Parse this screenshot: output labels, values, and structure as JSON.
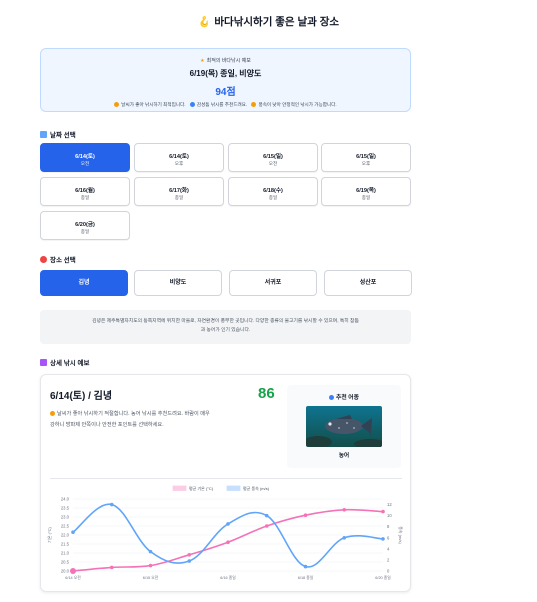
{
  "page": {
    "title": "바다낚시하기 좋은 날과 장소"
  },
  "best_forecast": {
    "label": "최적의 바다낚시 예보",
    "datetime": "6/19(목) 종일, 비양도",
    "score": "94점",
    "tips": [
      "날씨가 좋아 낚시하기 최적입니다.",
      "감성돔 낚시를 추천드려요.",
      "풍속이 낮아 안정적인 낚시가 가능합니다."
    ],
    "tip_colors": [
      "#f59e0b",
      "#3b82f6",
      "#f59e0b"
    ]
  },
  "date_section": {
    "title": "날짜 선택",
    "dates": [
      {
        "date": "6/14(토)",
        "period": "오전",
        "active": true
      },
      {
        "date": "6/14(토)",
        "period": "오후",
        "active": false
      },
      {
        "date": "6/15(일)",
        "period": "오전",
        "active": false
      },
      {
        "date": "6/15(일)",
        "period": "오후",
        "active": false
      },
      {
        "date": "6/16(월)",
        "period": "종일",
        "active": false
      },
      {
        "date": "6/17(화)",
        "period": "종일",
        "active": false
      },
      {
        "date": "6/18(수)",
        "period": "종일",
        "active": false
      },
      {
        "date": "6/19(목)",
        "period": "종일",
        "active": false
      },
      {
        "date": "6/20(금)",
        "period": "종일",
        "active": false
      }
    ]
  },
  "location_section": {
    "title": "장소 선택",
    "locations": [
      {
        "name": "김녕",
        "active": true
      },
      {
        "name": "비양도",
        "active": false
      },
      {
        "name": "서귀포",
        "active": false
      },
      {
        "name": "성산포",
        "active": false
      }
    ],
    "description_line1": "김녕은 제주특별자치도의 동쪽지역에 위치한 마을로, 자연환경이 풍부한 곳입니다. 다양한 종류의 물고기를 낚시할 수 있으며, 특히 참돔",
    "description_line2": "과 농어가 인기 있습니다."
  },
  "detail_section": {
    "title": "상세 낚시 예보",
    "card_title": "6/14(토) / 김녕",
    "score": "86",
    "message_line1": "날씨가 좋아 낚시하기 적절합니다. 농어 낚시를 추천드려요. 바람이 매우",
    "message_line2": "강하니 방파제 안쪽이나 안전한 포인트를 선택하세요.",
    "recommended_fish": {
      "label": "추천 어종",
      "name": "농어"
    }
  },
  "colors": {
    "accent": "#2563eb",
    "score_green": "#16a34a",
    "temp_series": "#f472b6",
    "wave_series": "#60a5fa"
  },
  "chart_data": {
    "type": "line",
    "x": [
      "6/14 오전",
      "6/14 오후",
      "6/15 오전",
      "6/15 오후",
      "6/16 종일",
      "6/17 종일",
      "6/18 종일",
      "6/19 종일",
      "6/20 종일"
    ],
    "x_tick_labels": [
      "6/14 오전",
      "6/15 오전",
      "6/16 종일",
      "6/18 종일",
      "6/20 종일"
    ],
    "series": [
      {
        "name": "평균 기온 (°C)",
        "axis": "left",
        "color": "#f472b6",
        "values": [
          20.0,
          20.2,
          20.3,
          20.9,
          21.6,
          22.5,
          23.1,
          23.4,
          23.3
        ]
      },
      {
        "name": "평균 풍속 (m/s)",
        "axis": "right",
        "color": "#60a5fa",
        "values": [
          7,
          12,
          3.5,
          1.8,
          8.5,
          10,
          0.8,
          6,
          5.8
        ]
      }
    ],
    "ylabel_left": "기온 (°C)",
    "ylabel_right": "풍속 (m/s)",
    "y_left_ticks": [
      "20.0",
      "20.5",
      "21.0",
      "21.5",
      "22.0",
      "22.5",
      "23.0",
      "23.5",
      "24.0"
    ],
    "y_right_ticks": [
      "0",
      "2",
      "4",
      "6",
      "8",
      "10",
      "12"
    ],
    "ylim_left": [
      20,
      24
    ],
    "ylim_right": [
      0,
      13
    ],
    "legend": "top",
    "grid": true
  }
}
